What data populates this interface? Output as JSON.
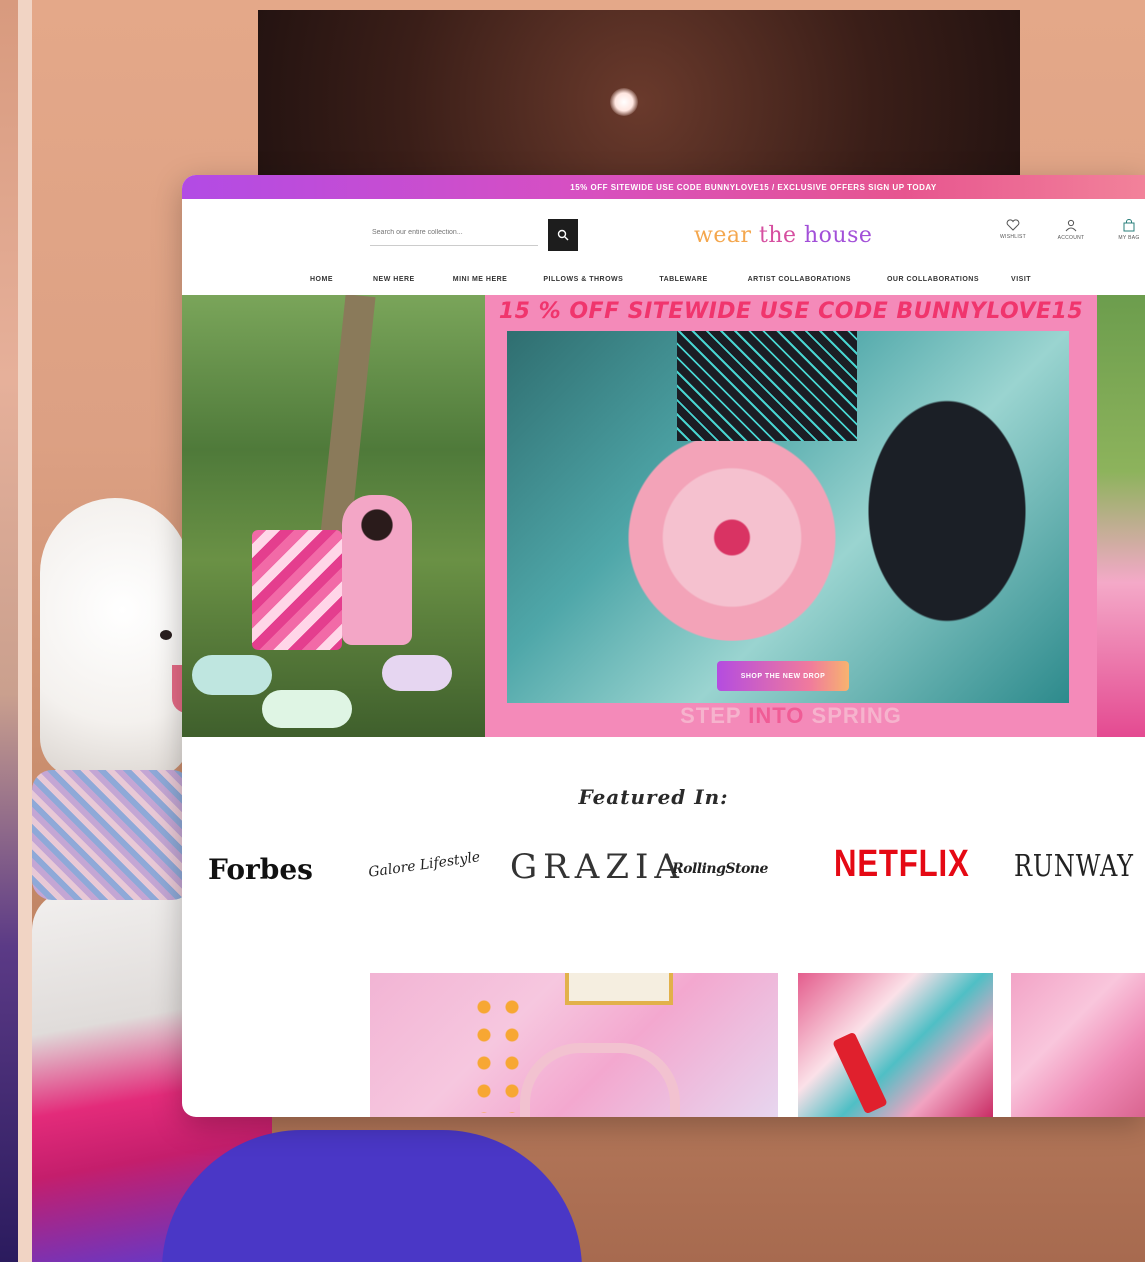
{
  "promo": {
    "text": "15% OFF SITEWIDE USE CODE BUNNYLOVE15 / EXCLUSIVE OFFERS SIGN UP TODAY"
  },
  "search": {
    "placeholder": "Search our entire collection..."
  },
  "logo": {
    "part1": "wear",
    "part2": "the",
    "part3": "house"
  },
  "header_icons": [
    {
      "label": "WISHLIST",
      "icon": "heart-icon"
    },
    {
      "label": "ACCOUNT",
      "icon": "user-icon"
    },
    {
      "label": "MY BAG",
      "icon": "bag-icon"
    }
  ],
  "nav": [
    "HOME",
    "NEW HERE",
    "MINI ME HERE",
    "PILLOWS & THROWS",
    "TABLEWARE",
    "ARTIST COLLABORATIONS",
    "OUR COLLABORATIONS",
    "VISIT"
  ],
  "hero": {
    "headline": "15 % OFF SITEWIDE USE CODE BUNNYLOVE15",
    "cta": "SHOP THE NEW DROP",
    "tagline_1": "STEP",
    "tagline_2": "INTO",
    "tagline_3": "SPRING"
  },
  "featured": {
    "title": "Featured In:",
    "logos": [
      "Forbes",
      "Galore Lifestyle",
      "GRAZIA",
      "RollingStone",
      "NETFLIX",
      "RUNWAY"
    ]
  },
  "colors": {
    "promo_start": "#b24be5",
    "promo_end": "#f2829a",
    "hero_pink": "#f48ab9",
    "headline_red": "#f0356d",
    "netflix_red": "#e50914"
  }
}
